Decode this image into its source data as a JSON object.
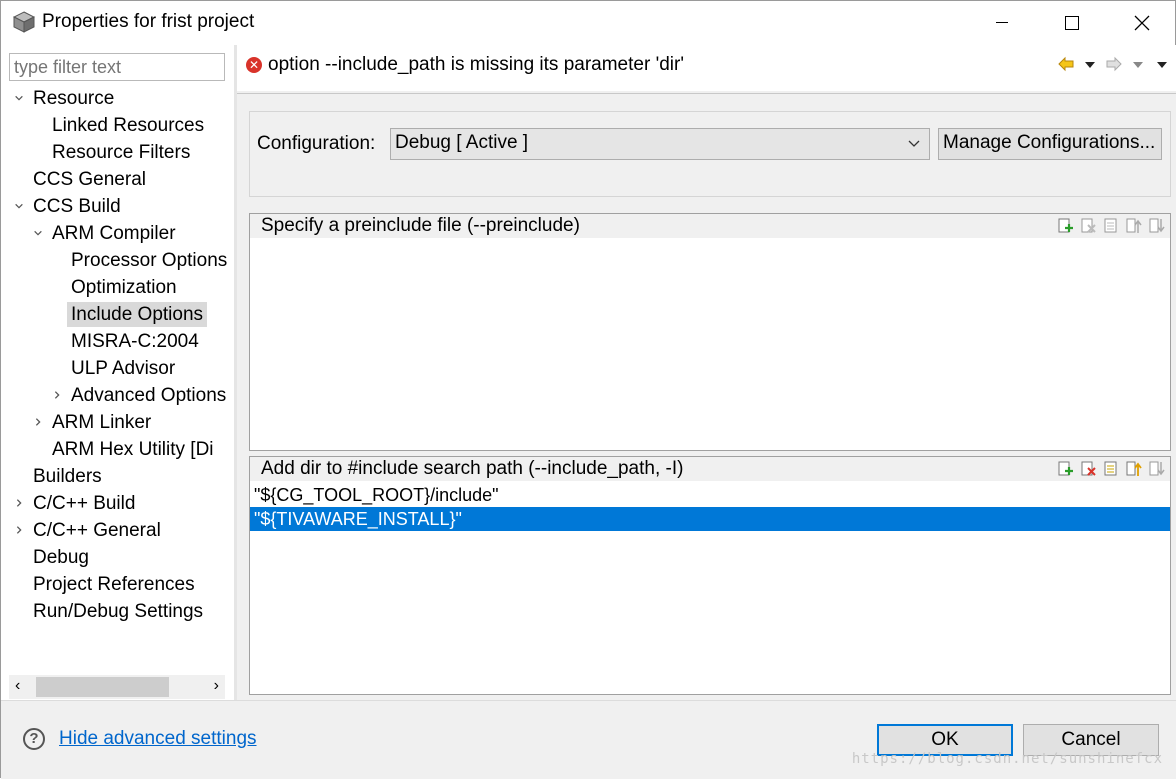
{
  "window": {
    "title": "Properties for frist project",
    "minimize_label": "—",
    "maximize_label": "□",
    "close_label": "✕"
  },
  "left": {
    "filter_placeholder": "type filter text",
    "tree": [
      {
        "label": "Resource",
        "indent": 0,
        "arrow": "expanded"
      },
      {
        "label": "Linked Resources",
        "indent": 1,
        "arrow": "none"
      },
      {
        "label": "Resource Filters",
        "indent": 1,
        "arrow": "none"
      },
      {
        "label": "CCS General",
        "indent": 0,
        "arrow": "none"
      },
      {
        "label": "CCS Build",
        "indent": 0,
        "arrow": "expanded"
      },
      {
        "label": "ARM Compiler",
        "indent": 1,
        "arrow": "expanded"
      },
      {
        "label": "Processor Options",
        "indent": 2,
        "arrow": "none"
      },
      {
        "label": "Optimization",
        "indent": 2,
        "arrow": "none"
      },
      {
        "label": "Include Options",
        "indent": 2,
        "arrow": "none",
        "selected": true
      },
      {
        "label": "MISRA-C:2004",
        "indent": 2,
        "arrow": "none"
      },
      {
        "label": "ULP Advisor",
        "indent": 2,
        "arrow": "none"
      },
      {
        "label": "Advanced Options",
        "indent": 2,
        "arrow": "collapsed"
      },
      {
        "label": "ARM Linker",
        "indent": 1,
        "arrow": "collapsed"
      },
      {
        "label": "ARM Hex Utility  [Di",
        "indent": 1,
        "arrow": "none"
      },
      {
        "label": "Builders",
        "indent": 0,
        "arrow": "none"
      },
      {
        "label": "C/C++ Build",
        "indent": 0,
        "arrow": "collapsed"
      },
      {
        "label": "C/C++ General",
        "indent": 0,
        "arrow": "collapsed"
      },
      {
        "label": "Debug",
        "indent": 0,
        "arrow": "none"
      },
      {
        "label": "Project References",
        "indent": 0,
        "arrow": "none"
      },
      {
        "label": "Run/Debug Settings",
        "indent": 0,
        "arrow": "none"
      }
    ]
  },
  "message": {
    "text": "option --include_path is missing its parameter 'dir'"
  },
  "config": {
    "label": "Configuration:",
    "value": "Debug  [ Active ]",
    "manage_label": "Manage Configurations..."
  },
  "preinclude": {
    "header": "Specify a preinclude file (--preinclude)",
    "items": []
  },
  "include_path": {
    "header": "Add dir to #include search path (--include_path, -I)",
    "items": [
      {
        "text": "\"${CG_TOOL_ROOT}/include\"",
        "selected": false
      },
      {
        "text": "\"${TIVAWARE_INSTALL}\"",
        "selected": true
      }
    ]
  },
  "bottom": {
    "hide_link": "Hide advanced settings",
    "ok_label": "OK",
    "cancel_label": "Cancel",
    "watermark": "https://blog.csdn.net/sunshinefcx"
  },
  "colors": {
    "selection": "#0078d7",
    "error": "#d9332a",
    "link": "#0066cc"
  }
}
